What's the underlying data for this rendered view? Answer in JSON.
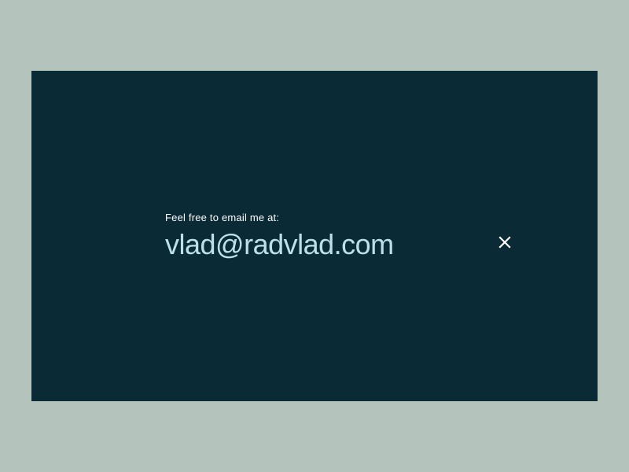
{
  "modal": {
    "prompt": "Feel free to email me at:",
    "email": "vlad@radvlad.com"
  }
}
